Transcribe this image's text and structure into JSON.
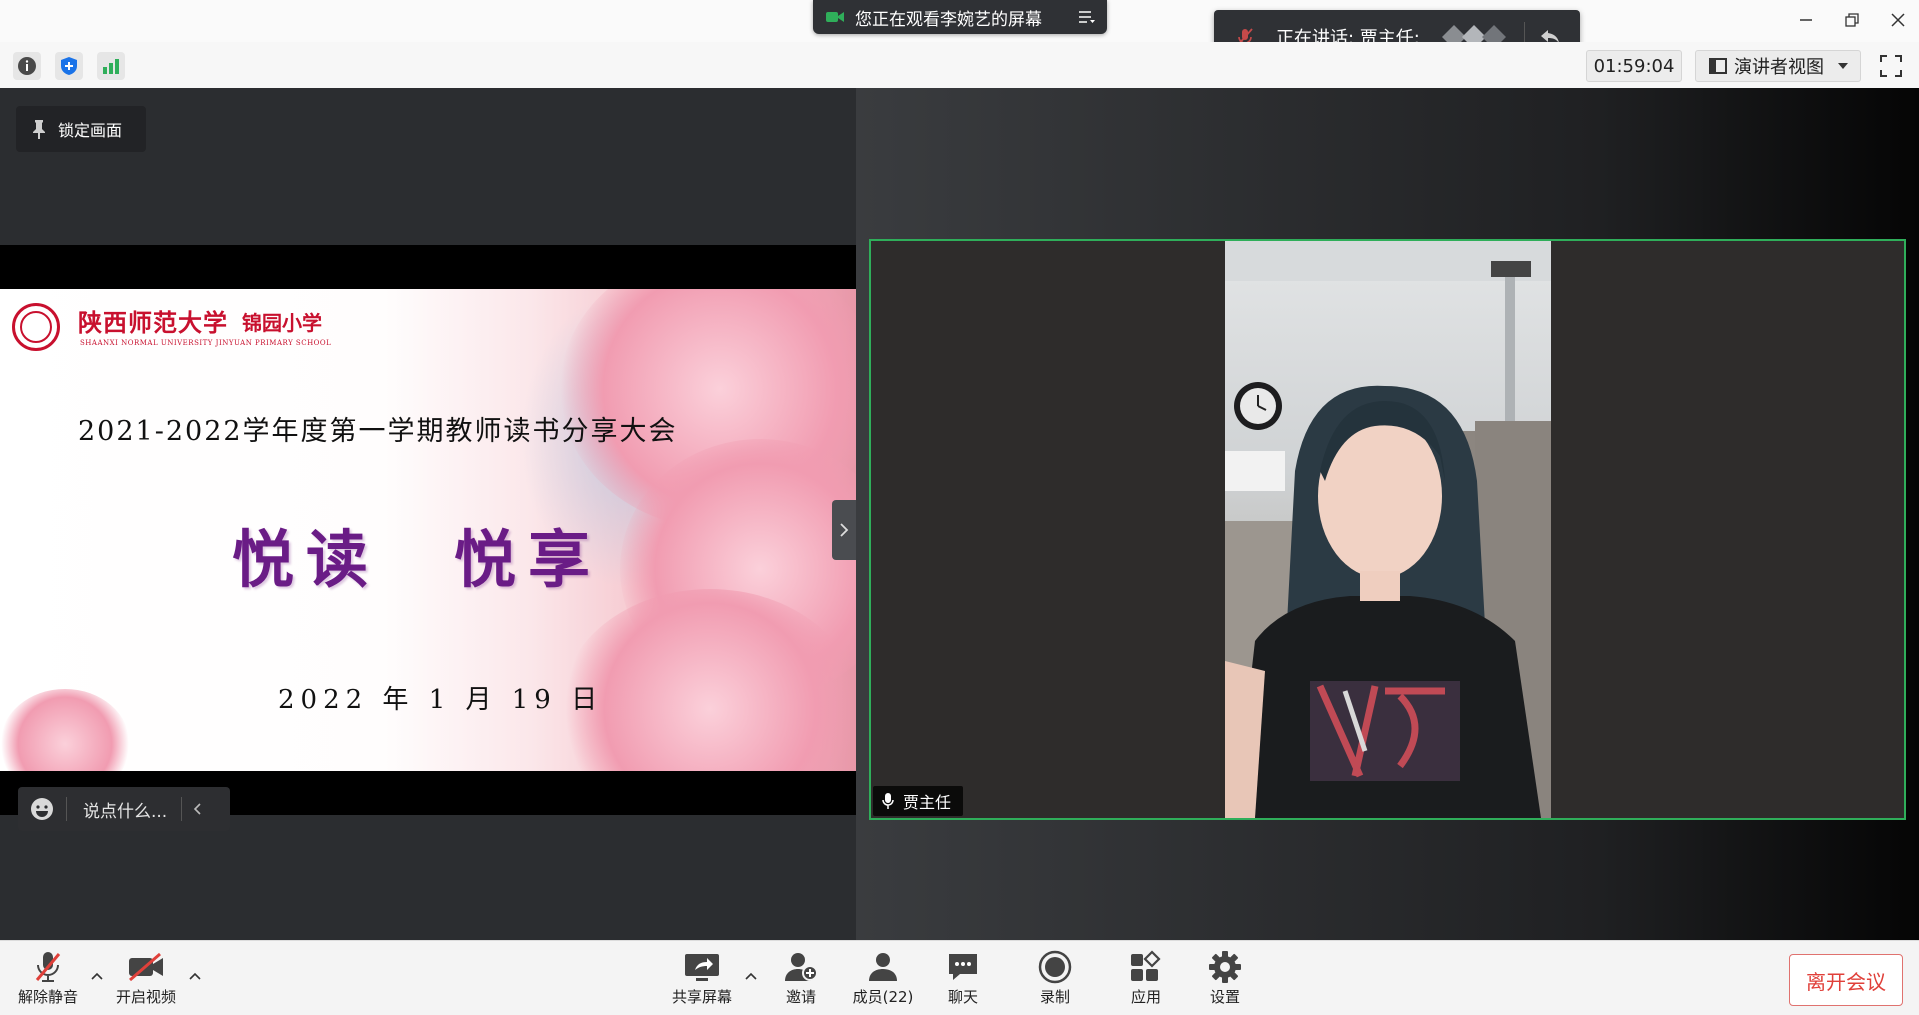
{
  "window": {
    "share_banner_text": "您正在观看李婉艺的屏幕",
    "speaking_label": "正在讲话: 贾主任;",
    "timer": "01:59:04",
    "view_mode": "演讲者视图"
  },
  "share": {
    "lock_label": "锁定画面",
    "chat_placeholder": "说点什么..."
  },
  "slide": {
    "university_name": "陕西师范大学",
    "school_name": "锦园小学",
    "university_subtitle": "SHAANXI NORMAL UNIVERSITY JINYUAN PRIMARY SCHOOL",
    "event_title": "2021-2022学年度第一学期教师读书分享大会",
    "main_title": "悦读　悦享",
    "date": "2022 年 1 月 19 日"
  },
  "speaker": {
    "name": "贾主任"
  },
  "bottom_toolbar": {
    "unmute": "解除静音",
    "start_video": "开启视频",
    "share_screen": "共享屏幕",
    "invite": "邀请",
    "members": "成员(22)",
    "chat": "聊天",
    "record": "录制",
    "apps": "应用",
    "settings": "设置",
    "leave": "离开会议"
  },
  "colors": {
    "accent_green": "#2fae5a",
    "leave_red": "#e0403a",
    "title_purple": "#6a1c86",
    "brand_red": "#c8102e"
  }
}
